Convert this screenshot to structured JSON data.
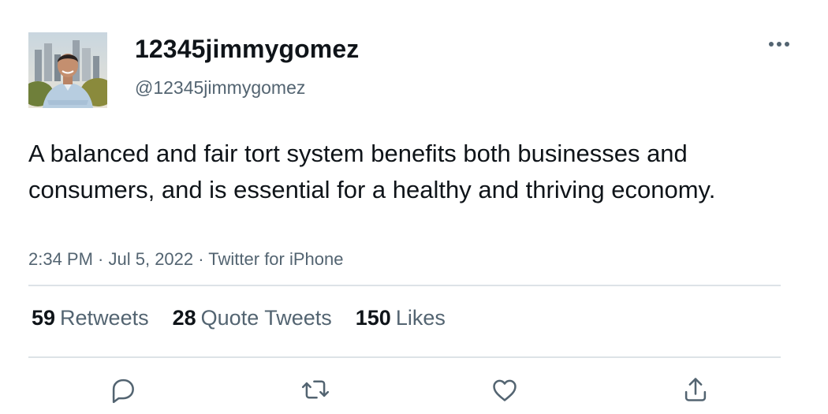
{
  "author": {
    "display_name": "12345jimmygomez",
    "handle": "@12345jimmygomez"
  },
  "tweet": {
    "text": "A balanced and fair tort system benefits both businesses and consumers, and is essential for a healthy and thriving economy.",
    "time": "2:34 PM",
    "separator1": " · ",
    "date": "Jul 5, 2022",
    "separator2": " · ",
    "source": "Twitter for iPhone"
  },
  "stats": {
    "retweets_count": "59",
    "retweets_label": "Retweets",
    "quotes_count": "28",
    "quotes_label": "Quote Tweets",
    "likes_count": "150",
    "likes_label": "Likes"
  },
  "icons": {
    "more": "more-dots-icon",
    "reply": "reply-icon",
    "retweet": "retweet-icon",
    "like": "heart-icon",
    "share": "share-icon"
  },
  "colors": {
    "primary_text": "#0f1419",
    "secondary_text": "#536471",
    "divider": "#dde3e7"
  }
}
